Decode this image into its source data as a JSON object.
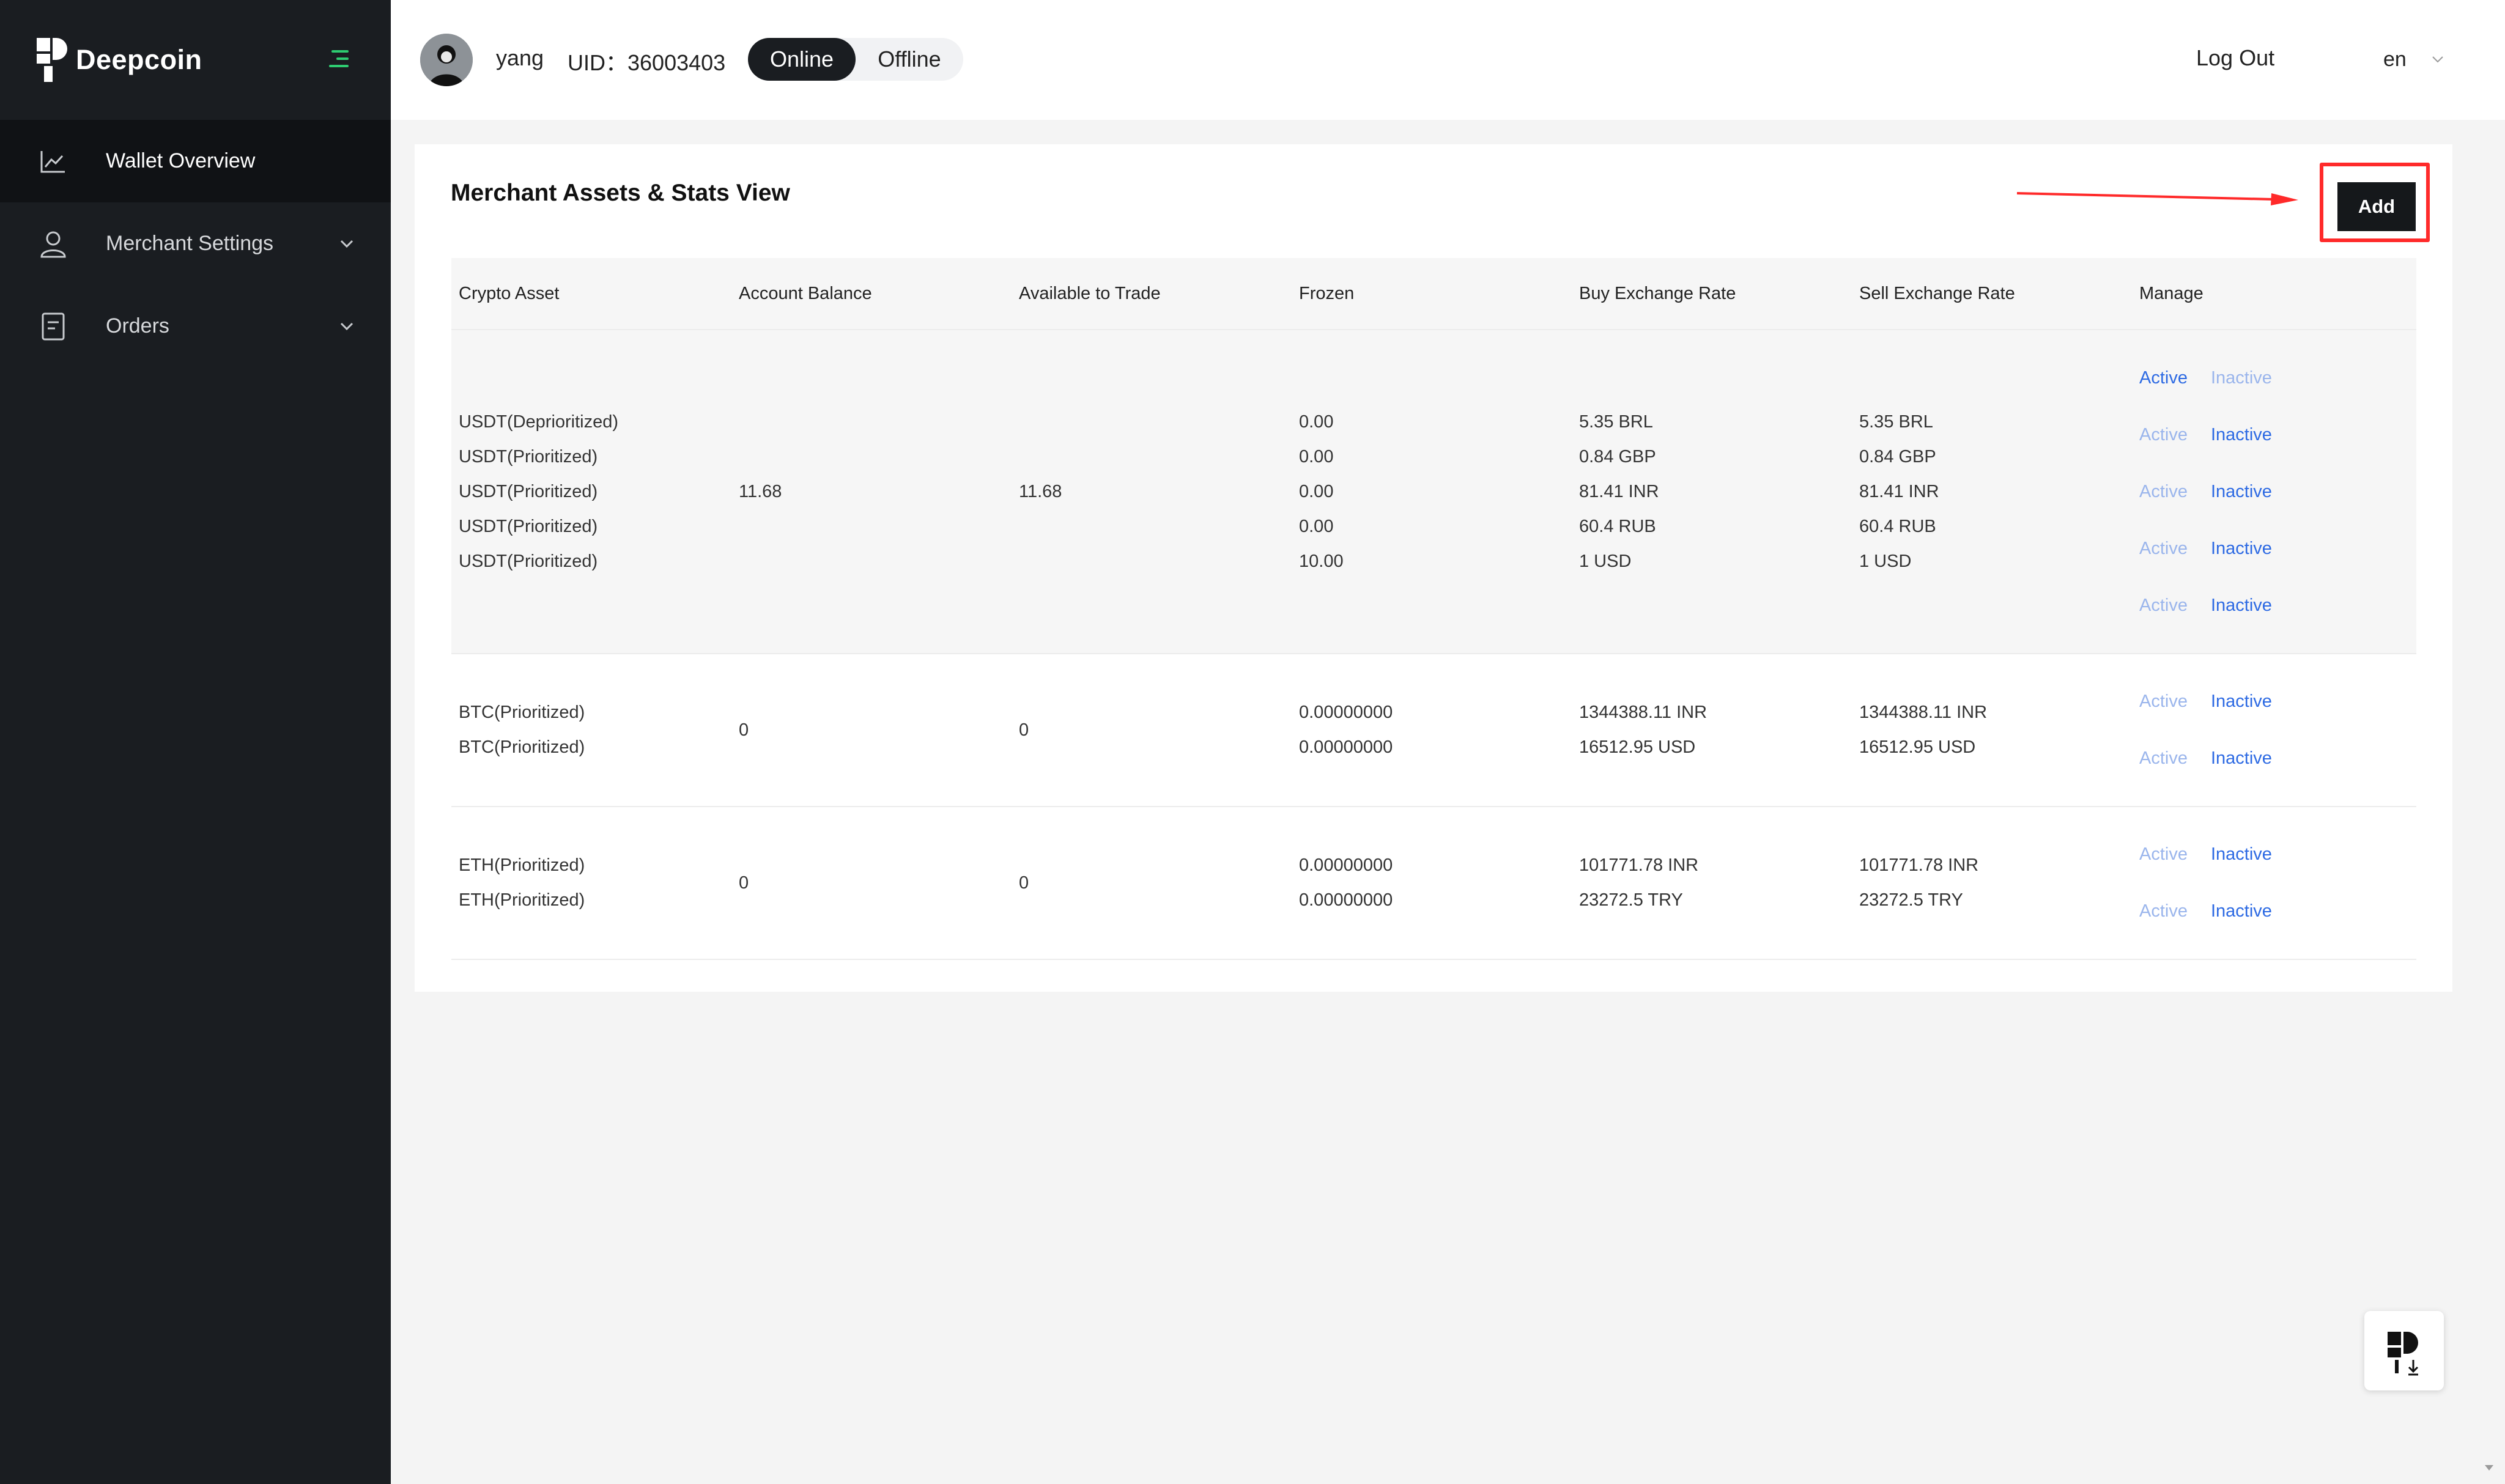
{
  "brand": {
    "name": "Deepcoin"
  },
  "sidebar": {
    "items": [
      {
        "label": "Wallet Overview",
        "icon": "chart-icon",
        "active": true
      },
      {
        "label": "Merchant Settings",
        "icon": "user-icon",
        "expandable": true
      },
      {
        "label": "Orders",
        "icon": "document-icon",
        "expandable": true
      }
    ]
  },
  "header": {
    "username": "yang",
    "uid": "UID：36003403",
    "status_online": "Online",
    "status_offline": "Offline",
    "logout": "Log Out",
    "language": "en"
  },
  "card": {
    "title": "Merchant Assets & Stats View",
    "add_label": "Add"
  },
  "table": {
    "columns": [
      "Crypto Asset",
      "Account Balance",
      "Available to Trade",
      "Frozen",
      "Buy Exchange Rate",
      "Sell Exchange Rate",
      "Manage"
    ],
    "groups": [
      {
        "balance": "11.68",
        "available": "11.68",
        "assets": [
          "USDT(Deprioritized)",
          "USDT(Prioritized)",
          "USDT(Prioritized)",
          "USDT(Prioritized)",
          "USDT(Prioritized)"
        ],
        "frozen": [
          "0.00",
          "0.00",
          "0.00",
          "0.00",
          "10.00"
        ],
        "buy": [
          "5.35 BRL",
          "0.84 GBP",
          "81.41 INR",
          "60.4 RUB",
          "1 USD"
        ],
        "sell": [
          "5.35 BRL",
          "0.84 GBP",
          "81.41 INR",
          "60.4 RUB",
          "1 USD"
        ],
        "manage": [
          {
            "active": "Active",
            "inactive": "Inactive",
            "state": "active"
          },
          {
            "active": "Active",
            "inactive": "Inactive",
            "state": "inactive"
          },
          {
            "active": "Active",
            "inactive": "Inactive",
            "state": "inactive"
          },
          {
            "active": "Active",
            "inactive": "Inactive",
            "state": "inactive"
          },
          {
            "active": "Active",
            "inactive": "Inactive",
            "state": "inactive"
          }
        ]
      },
      {
        "balance": "0",
        "available": "0",
        "assets": [
          "BTC(Prioritized)",
          "BTC(Prioritized)"
        ],
        "frozen": [
          "0.00000000",
          "0.00000000"
        ],
        "buy": [
          "1344388.11 INR",
          "16512.95 USD"
        ],
        "sell": [
          "1344388.11 INR",
          "16512.95 USD"
        ],
        "manage": [
          {
            "active": "Active",
            "inactive": "Inactive",
            "state": "inactive"
          },
          {
            "active": "Active",
            "inactive": "Inactive",
            "state": "inactive"
          }
        ]
      },
      {
        "balance": "0",
        "available": "0",
        "assets": [
          "ETH(Prioritized)",
          "ETH(Prioritized)"
        ],
        "frozen": [
          "0.00000000",
          "0.00000000"
        ],
        "buy": [
          "101771.78 INR",
          "23272.5 TRY"
        ],
        "sell": [
          "101771.78 INR",
          "23272.5 TRY"
        ],
        "manage": [
          {
            "active": "Active",
            "inactive": "Inactive",
            "state": "inactive"
          },
          {
            "active": "Active",
            "inactive": "Inactive",
            "state": "inactive"
          }
        ]
      }
    ]
  },
  "colors": {
    "sidebar_bg": "#1a1d21",
    "accent_green": "#2ecc71",
    "link_blue": "#2d6ae3",
    "highlight_red": "#ff2a2a"
  }
}
